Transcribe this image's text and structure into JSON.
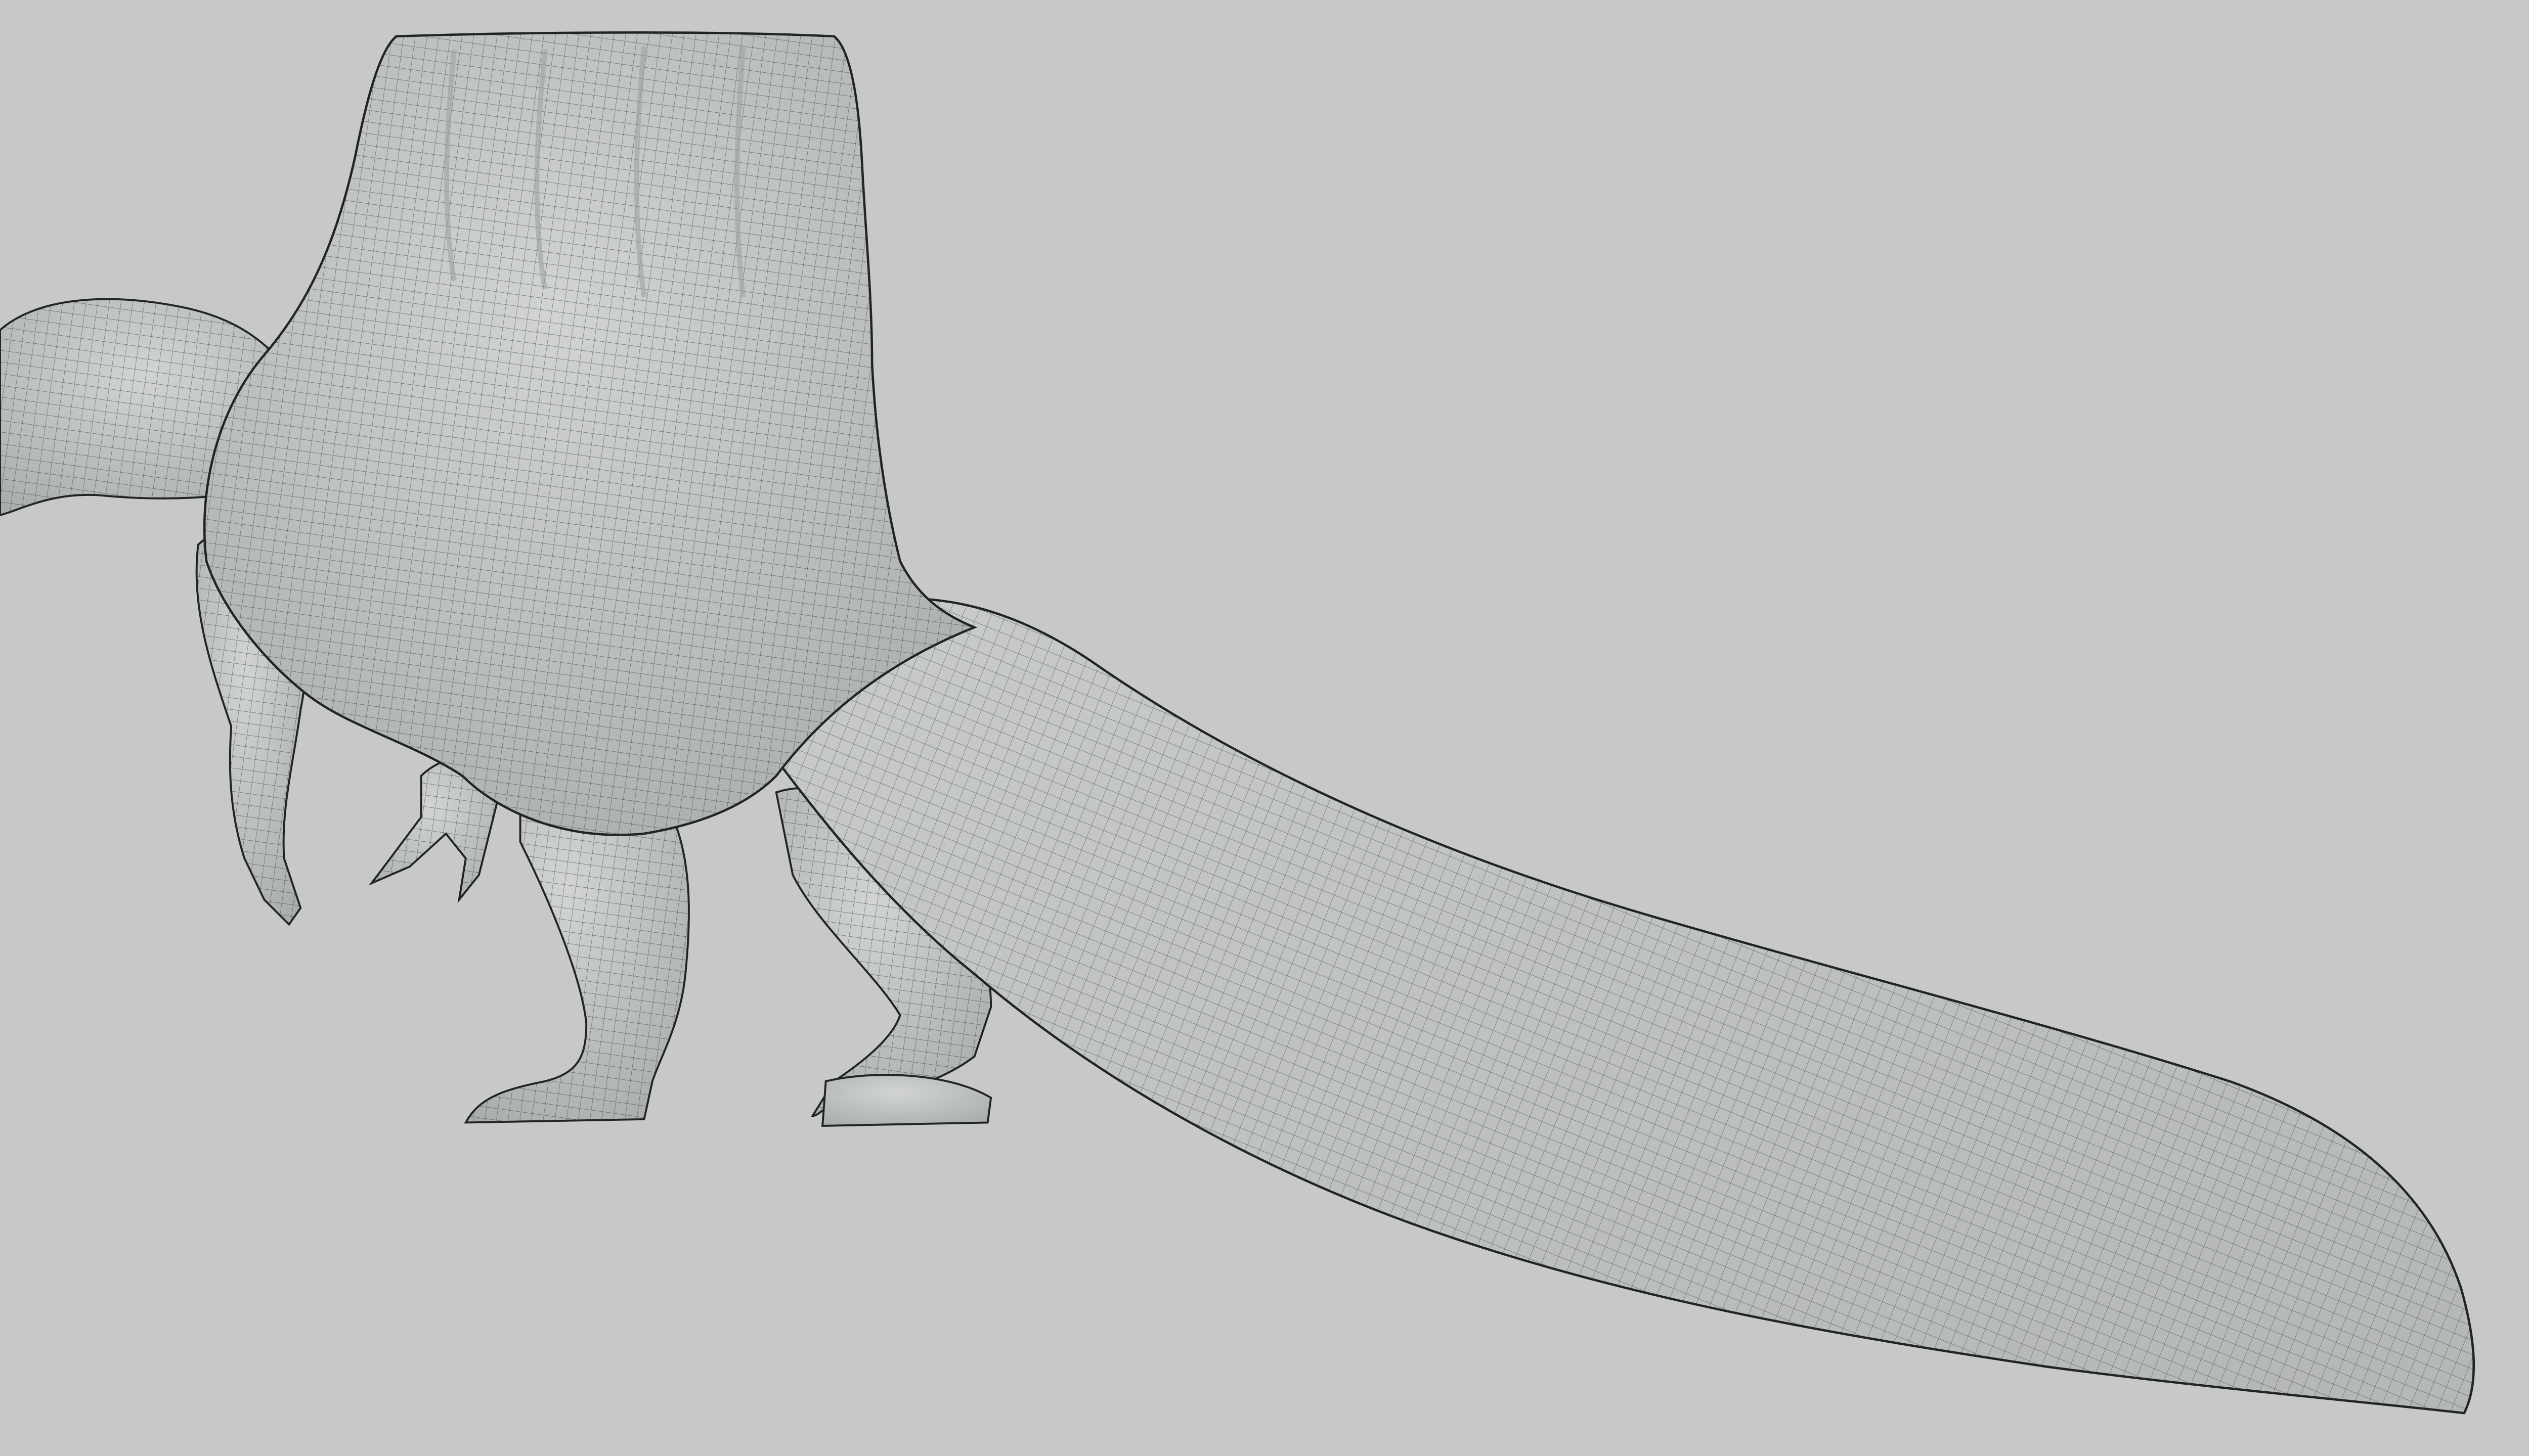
{
  "viewport": {
    "background_color": "#c8c8c8",
    "model": {
      "subject": "dinosaur-sculpt-wireframe",
      "surface_color": "#c4c6c6",
      "wire_color": "#2e3534",
      "outline_color": "#1f2524"
    }
  }
}
